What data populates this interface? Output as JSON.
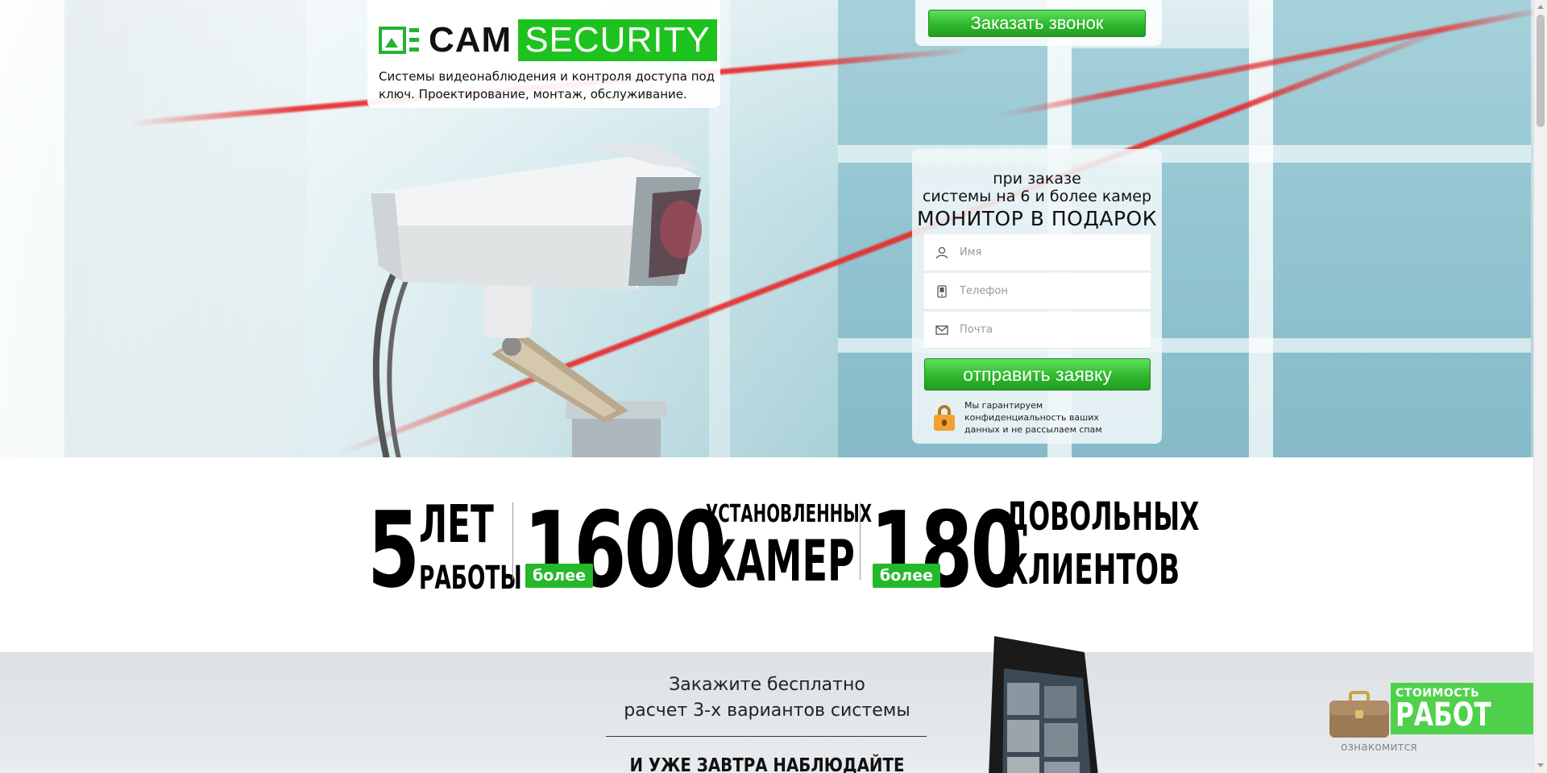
{
  "header": {
    "logo_cam": "CAM",
    "logo_security": "SECURITY",
    "tagline": "Системы видеонаблюдения и контроля доступа под ключ. Проектирование, монтаж, обслуживание.",
    "callback_label": "Заказать звонок"
  },
  "offer_form": {
    "line1": "при заказе",
    "line2": "системы на 6 и более камер",
    "line3": "МОНИТОР В ПОДАРОК",
    "name_placeholder": "Имя",
    "phone_placeholder": "Телефон",
    "email_placeholder": "Почта",
    "submit_label": "отправить заявку",
    "privacy": "Мы гарантируем конфиденциальность ваших данных и не рассылаем спам"
  },
  "stats": {
    "years_value": "5",
    "years_word1": "ЛЕТ",
    "years_word2": "РАБОТЫ",
    "cameras_value": "1600",
    "cameras_badge": "более",
    "cameras_word1": "УСТАНОВЛЕННЫХ",
    "cameras_word2": "КАМЕР",
    "clients_value": "180",
    "clients_badge": "более",
    "clients_word1": "ДОВОЛЬНЫХ",
    "clients_word2": "КЛИЕНТОВ"
  },
  "promo": {
    "line1": "Закажите бесплатно",
    "line2": "расчет 3-х вариантов системы",
    "line3": "И УЖЕ ЗАВТРА НАБЛЮДАЙТЕ ЗА"
  },
  "price_widget": {
    "line1": "СТОИМОСТЬ",
    "line2": "РАБОТ",
    "link": "ознакомится"
  },
  "colors": {
    "brand_green": "#1ec21e",
    "button_green": "#2fb82e",
    "badge_green": "#25b82a"
  },
  "icons": [
    "logo-icon",
    "user-icon",
    "phone-icon",
    "mail-icon",
    "lock-icon",
    "briefcase-icon"
  ]
}
